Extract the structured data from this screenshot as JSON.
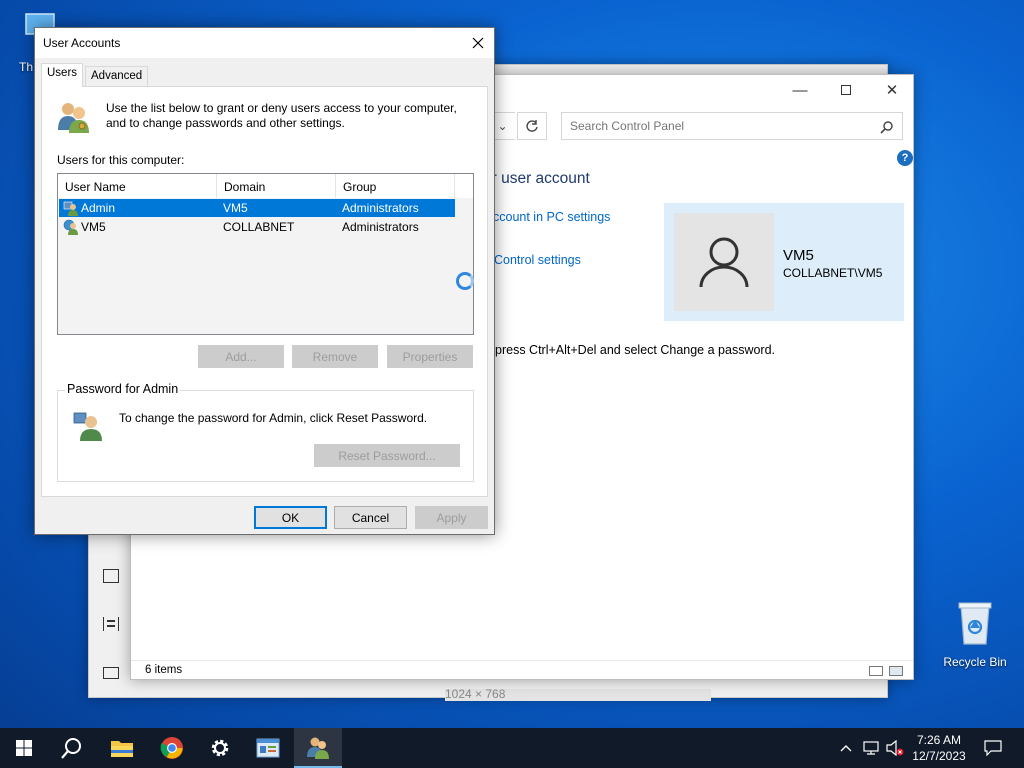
{
  "desktop": {
    "this_pc_label": "Th",
    "recycle_bin_label": "Recycle Bin"
  },
  "control_panel": {
    "search_placeholder": "Search Control Panel",
    "heading": "ur user account",
    "link_pc_settings": "ccount in PC settings",
    "link_control_settings": "Control settings",
    "hint_text": "press Ctrl+Alt+Del and select Change a password.",
    "account_name": "VM5",
    "account_domain": "COLLABNET\\VM5",
    "status_items": "6 items",
    "bottom_text": "1024 × 768"
  },
  "dialog": {
    "title": "User Accounts",
    "tabs": [
      {
        "label": "Users",
        "active": true
      },
      {
        "label": "Advanced",
        "active": false
      }
    ],
    "intro": "Use the list below to grant or deny users access to your computer, and to change passwords and other settings.",
    "users_label": "Users for this computer:",
    "columns": [
      "User Name",
      "Domain",
      "Group"
    ],
    "rows": [
      {
        "name": "Admin",
        "domain": "VM5",
        "group": "Administrators",
        "selected": true
      },
      {
        "name": "VM5",
        "domain": "COLLABNET",
        "group": "Administrators",
        "selected": false
      }
    ],
    "add_button": "Add...",
    "remove_button": "Remove",
    "properties_button": "Properties",
    "password_group_label": "Password for Admin",
    "password_text": "To change the password for Admin, click Reset Password.",
    "reset_button": "Reset Password...",
    "ok_button": "OK",
    "cancel_button": "Cancel",
    "apply_button": "Apply"
  },
  "taskbar": {
    "time": "7:26 AM",
    "date": "12/7/2023"
  },
  "colors": {
    "accent": "#0078d7",
    "link": "#0066cc",
    "taskbar": "#101a28"
  }
}
